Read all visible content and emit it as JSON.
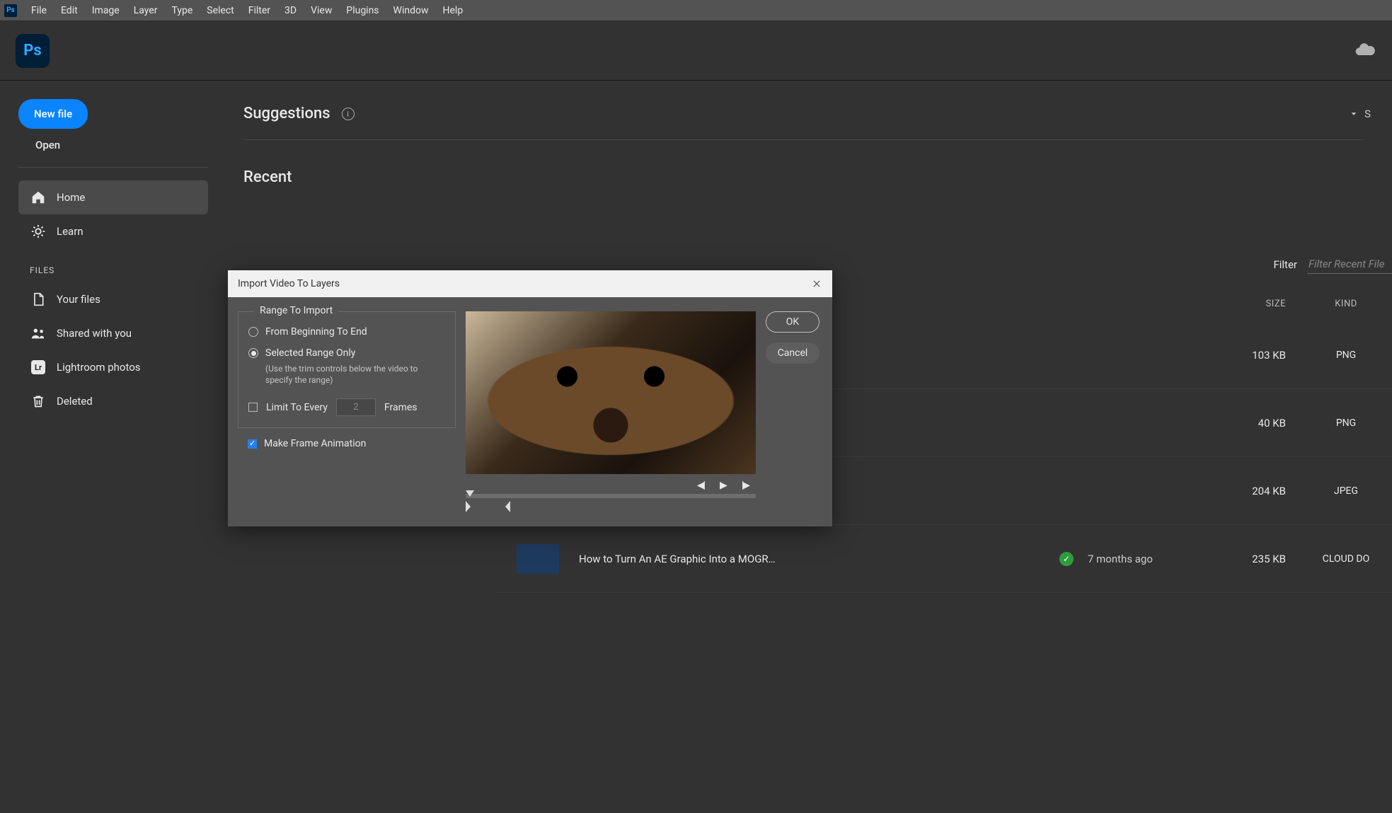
{
  "menubar": {
    "app_abbrev": "Ps",
    "items": [
      "File",
      "Edit",
      "Image",
      "Layer",
      "Type",
      "Select",
      "Filter",
      "3D",
      "View",
      "Plugins",
      "Window",
      "Help"
    ]
  },
  "logo_text": "Ps",
  "sidebar": {
    "new_file": "New file",
    "open": "Open",
    "nav": [
      {
        "label": "Home",
        "icon": "home"
      },
      {
        "label": "Learn",
        "icon": "learn"
      }
    ],
    "files_header": "FILES",
    "files_nav": [
      {
        "label": "Your files",
        "icon": "doc"
      },
      {
        "label": "Shared with you",
        "icon": "people"
      },
      {
        "label": "Lightroom photos",
        "icon": "lr"
      },
      {
        "label": "Deleted",
        "icon": "trash"
      }
    ]
  },
  "content": {
    "suggestions_title": "Suggestions",
    "suggestions_toggle_abbrev": "S",
    "recent_title": "Recent",
    "filter_label": "Filter",
    "filter_placeholder": "Filter Recent File",
    "columns": {
      "size": "SIZE",
      "kind": "KIND"
    },
    "rows": [
      {
        "size": "103 KB",
        "kind": "PNG"
      },
      {
        "size": "40 KB",
        "kind": "PNG"
      },
      {
        "size": "204 KB",
        "kind": "JPEG"
      },
      {
        "name": "How to Turn An AE Graphic Into a MOGR…",
        "ago": "7 months ago",
        "size": "235 KB",
        "kind": "CLOUD DO"
      }
    ]
  },
  "dialog": {
    "title": "Import Video To Layers",
    "range_legend": "Range To Import",
    "opt_beginning": "From Beginning To End",
    "opt_selected": "Selected Range Only",
    "hint": "(Use the trim controls below the video to specify the range)",
    "limit_label": "Limit To Every",
    "limit_value": "2",
    "frames_label": "Frames",
    "make_frame_anim": "Make Frame Animation",
    "ok": "OK",
    "cancel": "Cancel"
  }
}
